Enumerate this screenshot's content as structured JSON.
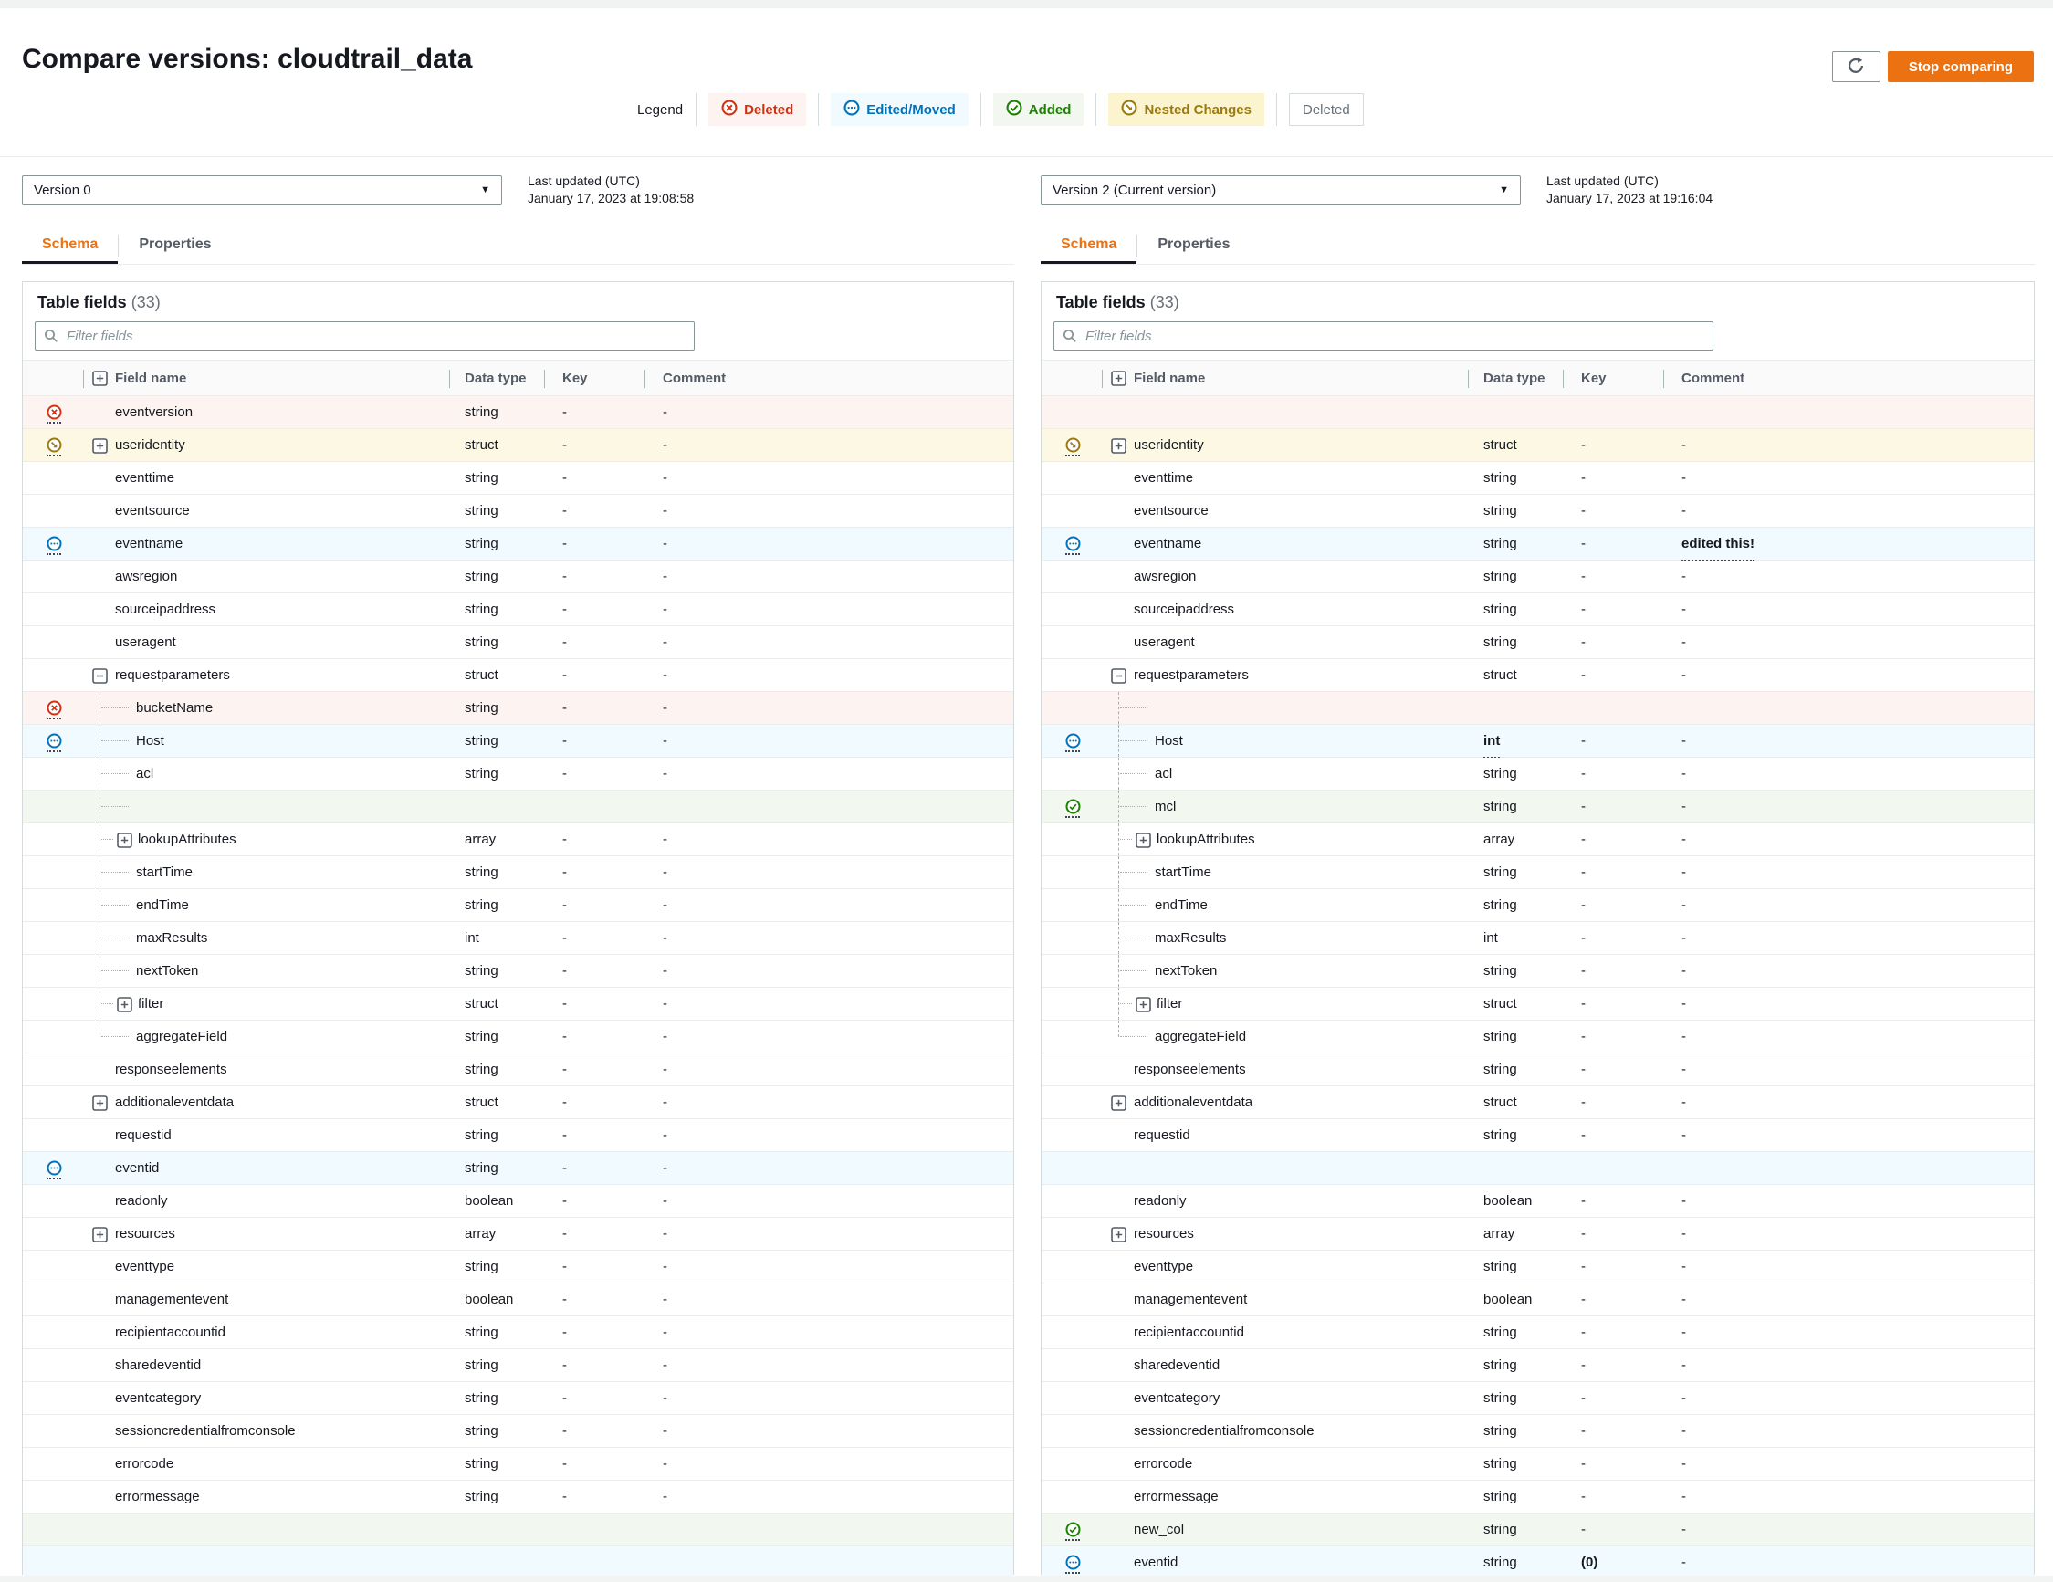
{
  "header": {
    "title": "Compare versions: cloudtrail_data",
    "stop_button": "Stop comparing",
    "refresh_icon": "refresh-icon"
  },
  "legend": {
    "label": "Legend",
    "items": [
      {
        "label": "Deleted",
        "kind": "deleted",
        "icon": "circle-x-icon",
        "color": "#d13212",
        "bg": "#fdf3f1"
      },
      {
        "label": "Edited/Moved",
        "kind": "edited",
        "icon": "circle-ellipsis-icon",
        "color": "#0073bb",
        "bg": "#f1faff"
      },
      {
        "label": "Added",
        "kind": "added",
        "icon": "circle-check-icon",
        "color": "#1d8102",
        "bg": "#f2f8f0"
      },
      {
        "label": "Nested Changes",
        "kind": "nested",
        "icon": "circle-arrow-down-right-icon",
        "color": "#9a7b12",
        "bg": "#fbf4ce"
      },
      {
        "label": "Deleted",
        "kind": "plain",
        "icon": "none",
        "color": "#687078",
        "bg": "#ffffff"
      }
    ]
  },
  "colors": {
    "primary_button": "#ec7211",
    "active_tab": "#ec7211",
    "deleted": "#d13212",
    "deleted_bg": "#fdf3f1",
    "edited": "#0073bb",
    "edited_bg": "#f1faff",
    "added": "#1d8102",
    "added_bg": "#f2f8f0",
    "nested": "#9a7b12",
    "nested_bg": "#fdf8e4",
    "type_link": "#0073bb",
    "icon_gray": "#545b64"
  },
  "panels": [
    {
      "version": "Version 0",
      "updated_label": "Last updated (UTC)",
      "updated_value": "January 17, 2023 at 19:08:58",
      "tabs": [
        "Schema",
        "Properties"
      ],
      "active_tab": "Schema",
      "table_title": "Table fields",
      "table_count": "(33)",
      "filter_placeholder": "Filter fields",
      "columns": [
        "Field name",
        "Data type",
        "Key",
        "Comment"
      ],
      "rows": [
        {
          "n": "eventversion",
          "t": "string",
          "k": "-",
          "c": "-",
          "s": "deleted"
        },
        {
          "n": "useridentity",
          "t": "struct",
          "link": 1,
          "k": "-",
          "c": "-",
          "s": "nested",
          "exp": "plus"
        },
        {
          "n": "eventtime",
          "t": "string",
          "k": "-",
          "c": "-"
        },
        {
          "n": "eventsource",
          "t": "string",
          "k": "-",
          "c": "-"
        },
        {
          "n": "eventname",
          "t": "string",
          "k": "-",
          "c": "-",
          "s": "edited"
        },
        {
          "n": "awsregion",
          "t": "string",
          "k": "-",
          "c": "-"
        },
        {
          "n": "sourceipaddress",
          "t": "string",
          "k": "-",
          "c": "-"
        },
        {
          "n": "useragent",
          "t": "string",
          "k": "-",
          "c": "-"
        },
        {
          "n": "requestparameters",
          "t": "struct",
          "link": 1,
          "k": "-",
          "c": "-",
          "exp": "minus"
        },
        {
          "n": "bucketName",
          "t": "string",
          "k": "-",
          "c": "-",
          "s": "deleted",
          "lvl": 1
        },
        {
          "n": "Host",
          "t": "string",
          "k": "-",
          "c": "-",
          "s": "edited",
          "lvl": 1
        },
        {
          "n": "acl",
          "t": "string",
          "k": "-",
          "c": "-",
          "lvl": 1
        },
        {
          "empty": 1,
          "s": "added",
          "lvl": 1
        },
        {
          "n": "lookupAttributes",
          "t": "array",
          "link": 1,
          "k": "-",
          "c": "-",
          "exp": "plus",
          "lvl": 1
        },
        {
          "n": "startTime",
          "t": "string",
          "k": "-",
          "c": "-",
          "lvl": 1
        },
        {
          "n": "endTime",
          "t": "string",
          "k": "-",
          "c": "-",
          "lvl": 1
        },
        {
          "n": "maxResults",
          "t": "int",
          "k": "-",
          "c": "-",
          "lvl": 1
        },
        {
          "n": "nextToken",
          "t": "string",
          "k": "-",
          "c": "-",
          "lvl": 1
        },
        {
          "n": "filter",
          "t": "struct",
          "link": 1,
          "k": "-",
          "c": "-",
          "exp": "plus",
          "lvl": 1
        },
        {
          "n": "aggregateField",
          "t": "string",
          "k": "-",
          "c": "-",
          "lvl": 1,
          "last": 1
        },
        {
          "n": "responseelements",
          "t": "string",
          "k": "-",
          "c": "-"
        },
        {
          "n": "additionaleventdata",
          "t": "struct",
          "link": 1,
          "k": "-",
          "c": "-",
          "exp": "plus"
        },
        {
          "n": "requestid",
          "t": "string",
          "k": "-",
          "c": "-"
        },
        {
          "n": "eventid",
          "t": "string",
          "k": "-",
          "c": "-",
          "s": "edited"
        },
        {
          "n": "readonly",
          "t": "boolean",
          "k": "-",
          "c": "-"
        },
        {
          "n": "resources",
          "t": "array",
          "link": 1,
          "k": "-",
          "c": "-",
          "exp": "plus"
        },
        {
          "n": "eventtype",
          "t": "string",
          "k": "-",
          "c": "-"
        },
        {
          "n": "managementevent",
          "t": "boolean",
          "k": "-",
          "c": "-"
        },
        {
          "n": "recipientaccountid",
          "t": "string",
          "k": "-",
          "c": "-"
        },
        {
          "n": "sharedeventid",
          "t": "string",
          "k": "-",
          "c": "-"
        },
        {
          "n": "eventcategory",
          "t": "string",
          "k": "-",
          "c": "-"
        },
        {
          "n": "sessioncredentialfromconsole",
          "t": "string",
          "k": "-",
          "c": "-"
        },
        {
          "n": "errorcode",
          "t": "string",
          "k": "-",
          "c": "-"
        },
        {
          "n": "errormessage",
          "t": "string",
          "k": "-",
          "c": "-"
        },
        {
          "empty": 1,
          "s": "added"
        },
        {
          "empty": 1,
          "s": "edited"
        }
      ]
    },
    {
      "version": "Version 2 (Current version)",
      "updated_label": "Last updated (UTC)",
      "updated_value": "January 17, 2023 at 19:16:04",
      "tabs": [
        "Schema",
        "Properties"
      ],
      "active_tab": "Schema",
      "table_title": "Table fields",
      "table_count": "(33)",
      "filter_placeholder": "Filter fields",
      "columns": [
        "Field name",
        "Data type",
        "Key",
        "Comment"
      ],
      "rows": [
        {
          "empty": 1,
          "s": "deleted"
        },
        {
          "n": "useridentity",
          "t": "struct",
          "link": 1,
          "k": "-",
          "c": "-",
          "s": "nested",
          "exp": "plus"
        },
        {
          "n": "eventtime",
          "t": "string",
          "k": "-",
          "c": "-"
        },
        {
          "n": "eventsource",
          "t": "string",
          "k": "-",
          "c": "-"
        },
        {
          "n": "eventname",
          "t": "string",
          "k": "-",
          "c": "edited this!",
          "cb": 1,
          "s": "edited"
        },
        {
          "n": "awsregion",
          "t": "string",
          "k": "-",
          "c": "-"
        },
        {
          "n": "sourceipaddress",
          "t": "string",
          "k": "-",
          "c": "-"
        },
        {
          "n": "useragent",
          "t": "string",
          "k": "-",
          "c": "-"
        },
        {
          "n": "requestparameters",
          "t": "struct",
          "link": 1,
          "k": "-",
          "c": "-",
          "exp": "minus"
        },
        {
          "empty": 1,
          "s": "deleted",
          "lvl": 1
        },
        {
          "n": "Host",
          "t": "int",
          "tb": 1,
          "k": "-",
          "c": "-",
          "s": "edited",
          "lvl": 1
        },
        {
          "n": "acl",
          "t": "string",
          "k": "-",
          "c": "-",
          "lvl": 1
        },
        {
          "n": "mcl",
          "t": "string",
          "k": "-",
          "c": "-",
          "s": "added",
          "lvl": 1
        },
        {
          "n": "lookupAttributes",
          "t": "array",
          "link": 1,
          "k": "-",
          "c": "-",
          "exp": "plus",
          "lvl": 1
        },
        {
          "n": "startTime",
          "t": "string",
          "k": "-",
          "c": "-",
          "lvl": 1
        },
        {
          "n": "endTime",
          "t": "string",
          "k": "-",
          "c": "-",
          "lvl": 1
        },
        {
          "n": "maxResults",
          "t": "int",
          "k": "-",
          "c": "-",
          "lvl": 1
        },
        {
          "n": "nextToken",
          "t": "string",
          "k": "-",
          "c": "-",
          "lvl": 1
        },
        {
          "n": "filter",
          "t": "struct",
          "link": 1,
          "k": "-",
          "c": "-",
          "exp": "plus",
          "lvl": 1
        },
        {
          "n": "aggregateField",
          "t": "string",
          "k": "-",
          "c": "-",
          "lvl": 1,
          "last": 1
        },
        {
          "n": "responseelements",
          "t": "string",
          "k": "-",
          "c": "-"
        },
        {
          "n": "additionaleventdata",
          "t": "struct",
          "link": 1,
          "k": "-",
          "c": "-",
          "exp": "plus"
        },
        {
          "n": "requestid",
          "t": "string",
          "k": "-",
          "c": "-"
        },
        {
          "empty": 1,
          "s": "edited"
        },
        {
          "n": "readonly",
          "t": "boolean",
          "k": "-",
          "c": "-"
        },
        {
          "n": "resources",
          "t": "array",
          "link": 1,
          "k": "-",
          "c": "-",
          "exp": "plus"
        },
        {
          "n": "eventtype",
          "t": "string",
          "k": "-",
          "c": "-"
        },
        {
          "n": "managementevent",
          "t": "boolean",
          "k": "-",
          "c": "-"
        },
        {
          "n": "recipientaccountid",
          "t": "string",
          "k": "-",
          "c": "-"
        },
        {
          "n": "sharedeventid",
          "t": "string",
          "k": "-",
          "c": "-"
        },
        {
          "n": "eventcategory",
          "t": "string",
          "k": "-",
          "c": "-"
        },
        {
          "n": "sessioncredentialfromconsole",
          "t": "string",
          "k": "-",
          "c": "-"
        },
        {
          "n": "errorcode",
          "t": "string",
          "k": "-",
          "c": "-"
        },
        {
          "n": "errormessage",
          "t": "string",
          "k": "-",
          "c": "-"
        },
        {
          "n": "new_col",
          "t": "string",
          "k": "-",
          "c": "-",
          "s": "added"
        },
        {
          "n": "eventid",
          "t": "string",
          "k": "(0)",
          "kb": 1,
          "c": "-",
          "s": "edited"
        }
      ]
    }
  ]
}
